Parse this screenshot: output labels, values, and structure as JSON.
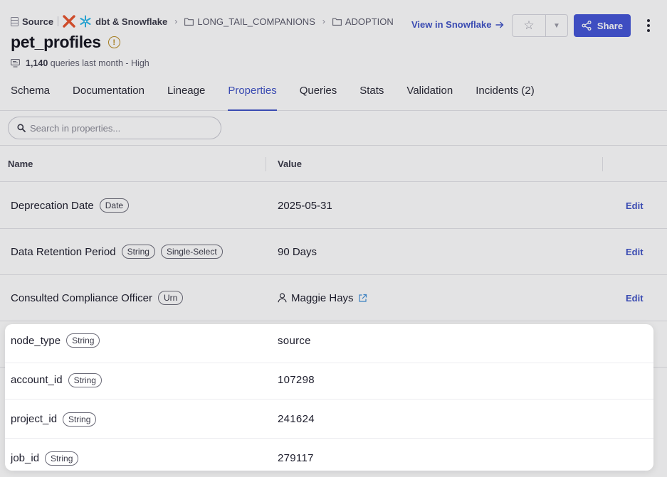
{
  "breadcrumb": {
    "source_label": "Source",
    "integration_label": "dbt & Snowflake",
    "database": "LONG_TAIL_COMPANIONS",
    "schema": "ADOPTION"
  },
  "asset": {
    "title": "pet_profiles",
    "query_count": "1,140",
    "query_suffix": "queries last month - High"
  },
  "actions": {
    "view_link": "View in Snowflake",
    "share_label": "Share"
  },
  "tabs": [
    {
      "label": "Schema"
    },
    {
      "label": "Documentation"
    },
    {
      "label": "Lineage"
    },
    {
      "label": "Properties",
      "active": true
    },
    {
      "label": "Queries"
    },
    {
      "label": "Stats"
    },
    {
      "label": "Validation"
    },
    {
      "label": "Incidents (2)"
    }
  ],
  "search": {
    "placeholder": "Search in properties..."
  },
  "table": {
    "headers": {
      "name": "Name",
      "value": "Value"
    },
    "edit_label": "Edit",
    "rows": [
      {
        "name": "Deprecation Date",
        "tags": [
          "Date"
        ],
        "value": "2025-05-31"
      },
      {
        "name": "Data Retention Period",
        "tags": [
          "String",
          "Single-Select"
        ],
        "value": "90 Days"
      },
      {
        "name": "Consulted Compliance Officer",
        "tags": [
          "Urn"
        ],
        "value": "Maggie Hays"
      }
    ]
  },
  "popover": {
    "rows": [
      {
        "name": "node_type",
        "tag": "String",
        "value": "source"
      },
      {
        "name": "account_id",
        "tag": "String",
        "value": "107298"
      },
      {
        "name": "project_id",
        "tag": "String",
        "value": "241624"
      },
      {
        "name": "job_id",
        "tag": "String",
        "value": "279117"
      }
    ]
  },
  "colors": {
    "accent": "#3f52c6",
    "share_bg": "#4455d8",
    "warning": "#b98a1e"
  }
}
